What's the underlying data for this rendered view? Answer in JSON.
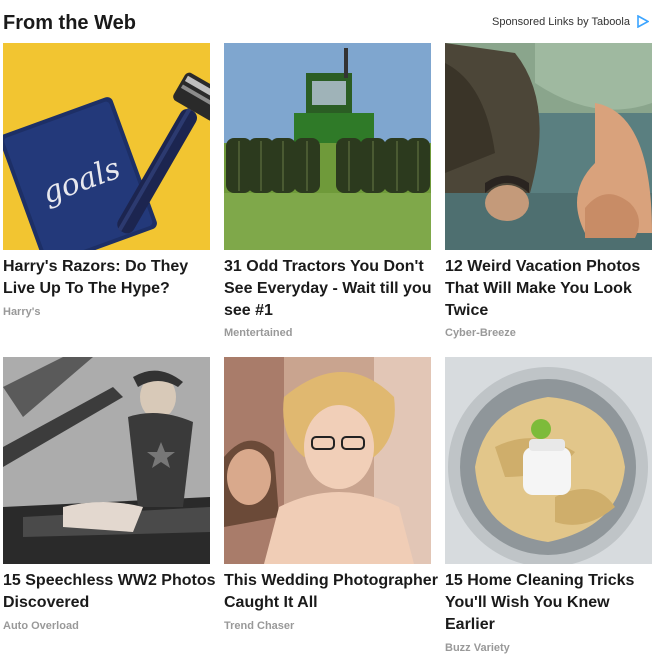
{
  "header": {
    "title": "From the Web",
    "sponsored_label": "Sponsored Links by Taboola"
  },
  "cards": [
    {
      "headline": "Harry's Razors: Do They Live Up To The Hype?",
      "source": "Harry's",
      "thumb_text": "goals"
    },
    {
      "headline": "31 Odd Tractors You Don't See Everyday - Wait till you see #1",
      "source": "Mentertained"
    },
    {
      "headline": "12 Weird Vacation Photos That Will Make You Look Twice",
      "source": "Cyber-Breeze"
    },
    {
      "headline": "15 Speechless WW2 Photos Discovered",
      "source": "Auto Overload"
    },
    {
      "headline": "This Wedding Photographer Caught It All",
      "source": "Trend Chaser"
    },
    {
      "headline": "15 Home Cleaning Tricks You'll Wish You Knew Earlier",
      "source": "Buzz Variety"
    }
  ],
  "colors": {
    "accent": "#3ba4ff",
    "brand_gray": "#999999"
  }
}
